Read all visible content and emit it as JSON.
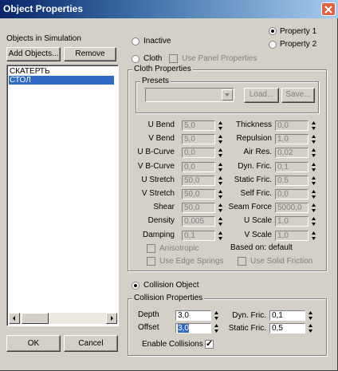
{
  "window": {
    "title": "Object Properties"
  },
  "left": {
    "objects_label": "Objects in Simulation",
    "add_objects": "Add Objects...",
    "remove": "Remove",
    "objects": [
      {
        "name": "СКАТЕРТЬ",
        "selected": false
      },
      {
        "name": "СТОЛ",
        "selected": true
      }
    ],
    "ok": "OK",
    "cancel": "Cancel"
  },
  "top": {
    "property1": "Property 1",
    "property2": "Property 2",
    "inactive": "Inactive",
    "cloth": "Cloth",
    "use_panel_properties": "Use Panel Properties"
  },
  "cloth": {
    "group_title": "Cloth Properties",
    "presets_title": "Presets",
    "load": "Load...",
    "save": "Save...",
    "left_params": [
      {
        "label": "U Bend",
        "value": "5,0"
      },
      {
        "label": "V Bend",
        "value": "5,0"
      },
      {
        "label": "U B-Curve",
        "value": "0,0"
      },
      {
        "label": "V B-Curve",
        "value": "0,0"
      },
      {
        "label": "U Stretch",
        "value": "50,0"
      },
      {
        "label": "V Stretch",
        "value": "50,0"
      },
      {
        "label": "Shear",
        "value": "50,0"
      },
      {
        "label": "Density",
        "value": "0,005"
      },
      {
        "label": "Damping",
        "value": "0,1"
      }
    ],
    "right_params": [
      {
        "label": "Thickness",
        "value": "0,0"
      },
      {
        "label": "Repulsion",
        "value": "1,0"
      },
      {
        "label": "Air Res.",
        "value": "0,02"
      },
      {
        "label": "Dyn. Fric.",
        "value": "0,1"
      },
      {
        "label": "Static Fric.",
        "value": "0,5"
      },
      {
        "label": "Self Fric.",
        "value": "0,0"
      },
      {
        "label": "Seam Force",
        "value": "5000,0"
      },
      {
        "label": "U Scale",
        "value": "1,0"
      },
      {
        "label": "V Scale",
        "value": "1,0"
      }
    ],
    "anisotropic": "Anisotropic",
    "based_on": "Based on: default",
    "use_edge_springs": "Use Edge Springs",
    "use_solid_friction": "Use Solid Friction"
  },
  "collision": {
    "collision_object": "Collision Object",
    "group_title": "Collision Properties",
    "depth_label": "Depth",
    "depth_value": "3,0",
    "offset_label": "Offset",
    "offset_value": "3,0",
    "dyn_fric_label": "Dyn. Fric.",
    "dyn_fric_value": "0,1",
    "static_fric_label": "Static Fric.",
    "static_fric_value": "0,5",
    "enable_collisions": "Enable Collisions"
  }
}
